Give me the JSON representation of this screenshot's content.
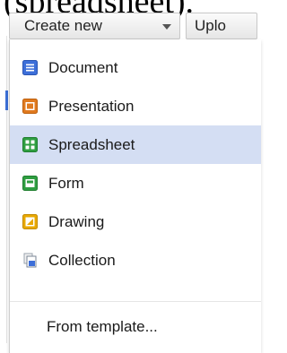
{
  "header": {
    "clipped_text": "(spreadsheet)."
  },
  "toolbar": {
    "create_label": "Create new",
    "upload_label": "Uplo"
  },
  "menu": {
    "items": [
      {
        "label": "Document",
        "icon": "document-icon",
        "color": "#3d6fd9"
      },
      {
        "label": "Presentation",
        "icon": "presentation-icon",
        "color": "#e07a1f"
      },
      {
        "label": "Spreadsheet",
        "icon": "spreadsheet-icon",
        "color": "#2f9e41",
        "highlighted": true
      },
      {
        "label": "Form",
        "icon": "form-icon",
        "color": "#2f9e41"
      },
      {
        "label": "Drawing",
        "icon": "drawing-icon",
        "color": "#e8a800"
      },
      {
        "label": "Collection",
        "icon": "collection-icon",
        "color": "#7a8594"
      }
    ],
    "template_label": "From template..."
  }
}
